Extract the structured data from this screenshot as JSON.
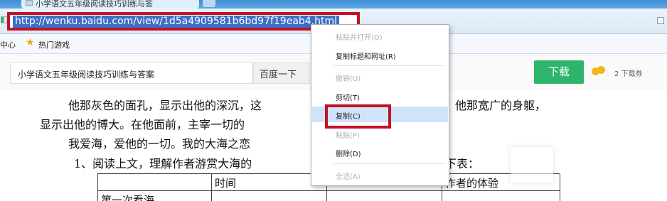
{
  "browser": {
    "tab_title": "小学语文五年级阅读技巧训练与答",
    "url": "http://wenku.baidu.com/view/1d5a4909581b6bd97f19eab4.html",
    "bookmarks": [
      "中心",
      "热门游戏"
    ]
  },
  "wenku": {
    "search_value": "小学语文五年级阅读技巧训练与答案",
    "search_button": "百度一下",
    "download_button": "下载",
    "ticket_text": "2 下载券"
  },
  "document": {
    "line1_left": "他那灰色的面孔，显示出他的深沉，这",
    "line1_right": "他那宽广的身躯，",
    "line2": "显示出他的博大。在他面前，主宰一切的",
    "line3": "我爱海，爱他的一切。我的大海之恋",
    "line4_left": "1、阅读上文，理解作者游赏大海的",
    "line4_right": "下表：",
    "table": {
      "headers": [
        "",
        "时间",
        "",
        "作者的体验"
      ],
      "rows": [
        [
          "第一次看海",
          "",
          "",
          ""
        ]
      ]
    }
  },
  "context_menu": {
    "items": [
      {
        "label": "粘贴并打开(O)",
        "enabled": false
      },
      {
        "label": "复制标题和网址(R)",
        "enabled": true
      },
      {
        "label": "撤销(U)",
        "enabled": false
      },
      {
        "label": "剪切(T)",
        "enabled": true
      },
      {
        "label": "复制(C)",
        "enabled": true,
        "highlighted": true
      },
      {
        "label": "粘贴(P)",
        "enabled": false
      },
      {
        "label": "删除(D)",
        "enabled": true
      },
      {
        "label": "全选(A)",
        "enabled": false
      }
    ]
  },
  "colors": {
    "highlight_border": "#c41224",
    "url_selection": "#3b6fc6",
    "download_green": "#2db56c",
    "menu_hover": "#cfe4f8"
  }
}
